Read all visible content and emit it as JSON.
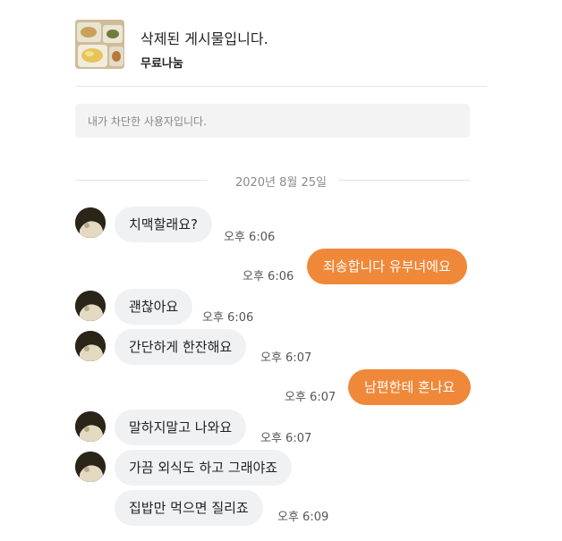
{
  "post": {
    "title": "삭제된 게시물입니다.",
    "subtitle": "무료나눔"
  },
  "notice": {
    "text": "내가 차단한 사용자입니다."
  },
  "chat": {
    "date": "2020년 8월 25일",
    "messages": [
      {
        "side": "received",
        "text": "치맥할래요?",
        "time": "오후 6:06"
      },
      {
        "side": "sent",
        "text": "죄송합니다 유부녀에요",
        "time": "오후 6:06"
      },
      {
        "side": "received",
        "text": "괜찮아요",
        "time": "오후 6:06"
      },
      {
        "side": "received",
        "text": "간단하게 한잔해요",
        "time": "오후 6:07"
      },
      {
        "side": "sent",
        "text": "남편한테 혼나요",
        "time": "오후 6:07"
      },
      {
        "side": "received",
        "text": "말하지말고 나와요",
        "time": "오후 6:07"
      },
      {
        "side": "received",
        "text": "가끔 외식도 하고 그래야죠",
        "time": ""
      },
      {
        "side": "received",
        "text": "집밥만 먹으면 질리죠",
        "time": "오후 6:09"
      }
    ]
  },
  "colors": {
    "sent_bubble": "#f0883a",
    "received_bubble": "#f0f1f3"
  }
}
